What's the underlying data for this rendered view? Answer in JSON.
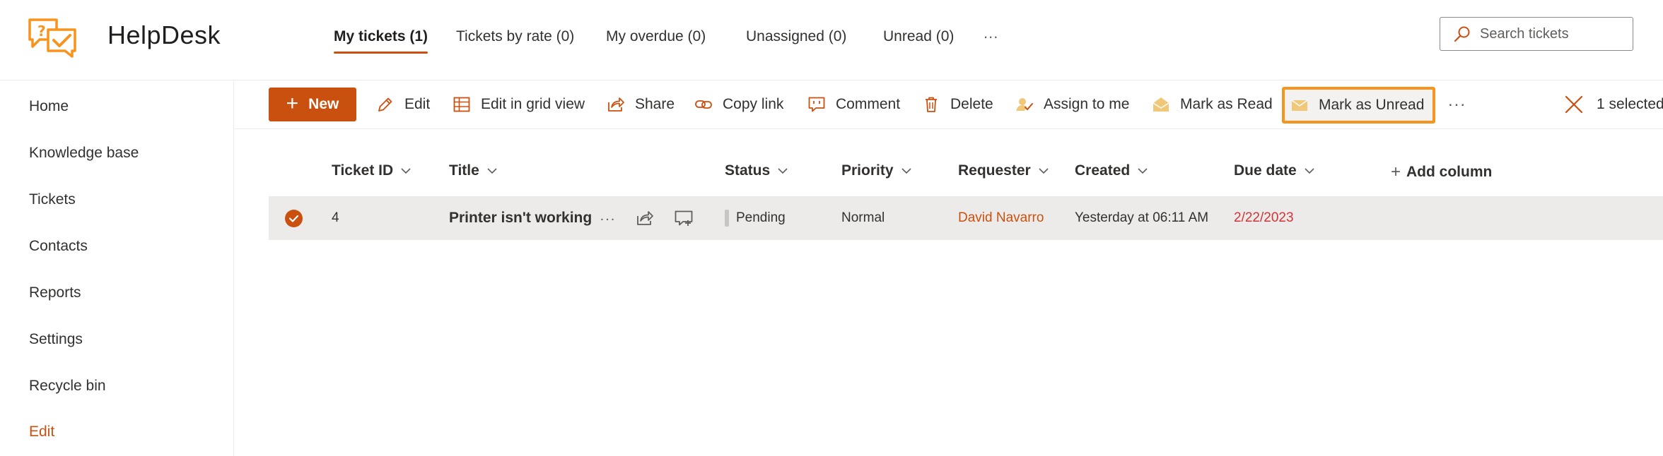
{
  "app": {
    "name": "HelpDesk",
    "colors": {
      "accent": "#ca5010",
      "highlight": "#f7941d",
      "due_date": "#d13438"
    }
  },
  "header": {
    "tabs": [
      {
        "label": "My tickets (1)",
        "active": true
      },
      {
        "label": "Tickets by rate (0)",
        "active": false
      },
      {
        "label": "My overdue (0)",
        "active": false
      },
      {
        "label": "Unassigned (0)",
        "active": false
      },
      {
        "label": "Unread (0)",
        "active": false
      }
    ],
    "more_label": "...",
    "search": {
      "placeholder": "Search tickets",
      "icon": "search-icon"
    }
  },
  "sidebar": {
    "items": [
      {
        "label": "Home"
      },
      {
        "label": "Knowledge base"
      },
      {
        "label": "Tickets"
      },
      {
        "label": "Contacts"
      },
      {
        "label": "Reports"
      },
      {
        "label": "Settings"
      },
      {
        "label": "Recycle bin"
      },
      {
        "label": "Edit"
      }
    ]
  },
  "commandbar": {
    "new_label": "New",
    "commands": [
      {
        "label": "Edit",
        "icon": "pencil-icon"
      },
      {
        "label": "Edit in grid view",
        "icon": "grid-icon"
      },
      {
        "label": "Share",
        "icon": "share-icon"
      },
      {
        "label": "Copy link",
        "icon": "link-icon"
      },
      {
        "label": "Comment",
        "icon": "comment-icon"
      },
      {
        "label": "Delete",
        "icon": "trash-icon"
      },
      {
        "label": "Assign to me",
        "icon": "assign-person-icon"
      },
      {
        "label": "Mark as Read",
        "icon": "envelope-open-icon"
      },
      {
        "label": "Mark as Unread",
        "icon": "envelope-closed-icon",
        "highlighted": true
      }
    ],
    "more_label": "...",
    "selected_label": "1 selected"
  },
  "table": {
    "columns": [
      "Ticket ID",
      "Title",
      "Status",
      "Priority",
      "Requester",
      "Created",
      "Due date"
    ],
    "add_column_label": "Add column",
    "rows": [
      {
        "selected": true,
        "ticket_id": "4",
        "title": "Printer isn't working",
        "row_more": "...",
        "status": "Pending",
        "priority": "Normal",
        "requester": "David Navarro",
        "created": "Yesterday at 06:11 AM",
        "due_date": "2/22/2023"
      }
    ]
  }
}
